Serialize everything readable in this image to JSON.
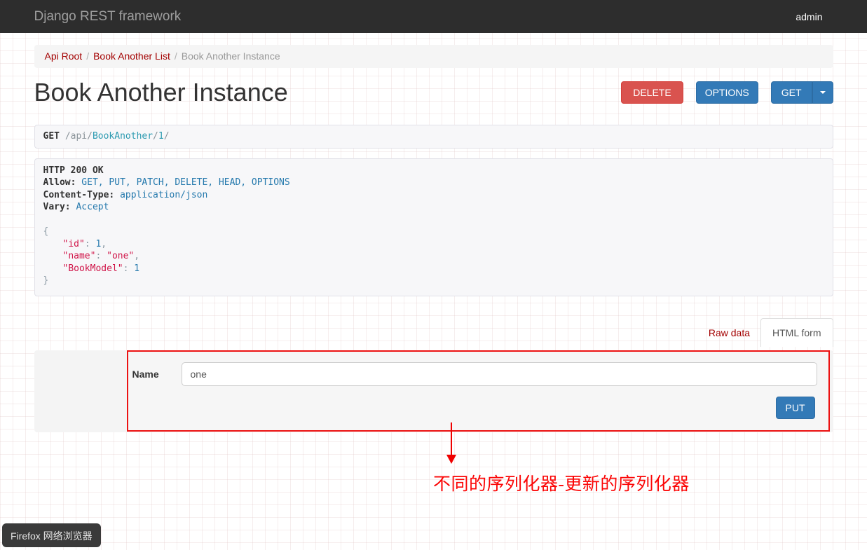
{
  "navbar": {
    "brand": "Django REST framework",
    "user": "admin"
  },
  "breadcrumb": {
    "separator": "/",
    "items": [
      {
        "label": "Api Root"
      },
      {
        "label": "Book Another List"
      },
      {
        "label": "Book Another Instance"
      }
    ]
  },
  "page": {
    "title": "Book Another Instance"
  },
  "actions": {
    "delete_label": "DELETE",
    "options_label": "OPTIONS",
    "get_label": "GET"
  },
  "request": {
    "method": "GET",
    "slash1": "/api/",
    "resource": "BookAnother",
    "slash2": "/",
    "id": "1",
    "slash3": "/"
  },
  "response": {
    "status_line": "HTTP 200 OK",
    "headers": [
      {
        "name": "Allow:",
        "value": "GET, PUT, PATCH, DELETE, HEAD, OPTIONS"
      },
      {
        "name": "Content-Type:",
        "value": "application/json"
      },
      {
        "name": "Vary:",
        "value": "Accept"
      }
    ],
    "body": {
      "open": "{",
      "close": "}",
      "fields": [
        {
          "key": "\"id\"",
          "colon": ":",
          "value": "1",
          "comma": ","
        },
        {
          "key": "\"name\"",
          "colon": ":",
          "value": "\"one\"",
          "comma": ","
        },
        {
          "key": "\"BookModel\"",
          "colon": ":",
          "value": "1",
          "comma": ""
        }
      ]
    }
  },
  "tabs": {
    "raw_data": "Raw data",
    "html_form": "HTML form"
  },
  "form": {
    "name_label": "Name",
    "name_value": "one",
    "submit_label": "PUT"
  },
  "annotation": {
    "text": "不同的序列化器-更新的序列化器"
  },
  "tooltip": {
    "text": "Firefox 网络浏览器"
  },
  "colors": {
    "navbar_bg": "#2d2d2d",
    "primary_blue": "#337ab7",
    "danger_red": "#d9534f",
    "link_red": "#a30000",
    "annotation_red": "#f00000",
    "code_string": "#d01448",
    "code_blue": "#2579ad",
    "code_teal": "#2b9ab0"
  }
}
